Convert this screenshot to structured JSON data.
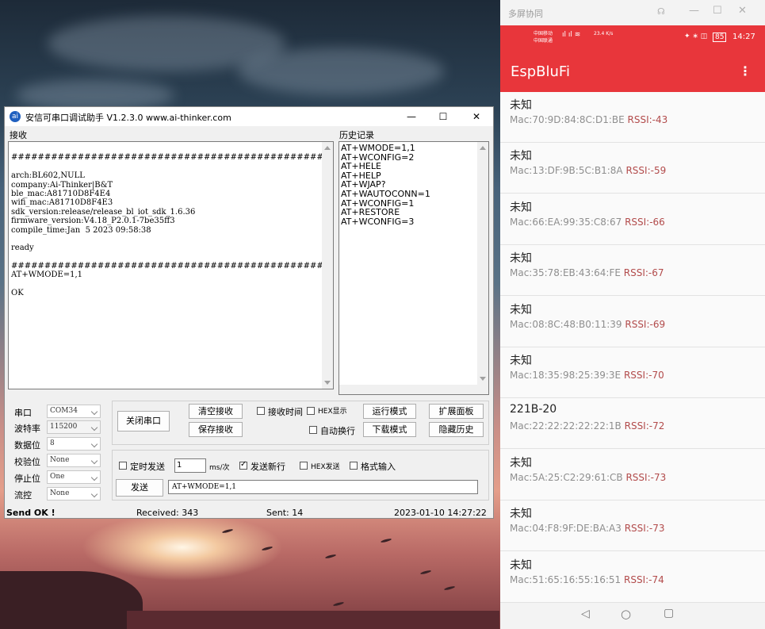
{
  "serial": {
    "title": "安信可串口调试助手 V1.2.3.0   www.ai-thinker.com",
    "receive_label": "接收",
    "history_label": "历史记录",
    "receive_lines": [
      "",
      "################################################",
      "",
      "arch:BL602,NULL",
      "company:Ai-Thinker|B&T",
      "ble_mac:A81710D8F4E4",
      "wifi_mac:A81710D8F4E3",
      "sdk_version:release/release_bl_iot_sdk_1.6.36",
      "firmware_version:V4.18_P2.0.1-7be35ff3",
      "compile_time:Jan  5 2023 09:58:38",
      "",
      "ready",
      "",
      "################################################",
      "AT+WMODE=1,1",
      "",
      "OK"
    ],
    "history": [
      "AT+WMODE=1,1",
      "AT+WCONFIG=2",
      "AT+HELE",
      "AT+HELP",
      "AT+WJAP?",
      "AT+WAUTOCONN=1",
      "AT+WCONFIG=1",
      "AT+RESTORE",
      "AT+WCONFIG=3"
    ],
    "port_label": "串口",
    "port_value": "COM34",
    "baud_label": "波特率",
    "baud_value": "115200",
    "databits_label": "数据位",
    "databits_value": "8",
    "parity_label": "校验位",
    "parity_value": "None",
    "stopbits_label": "停止位",
    "stopbits_value": "One",
    "flow_label": "流控",
    "flow_value": "None",
    "close_port": "关闭串口",
    "clear_recv": "清空接收",
    "save_recv": "保存接收",
    "recv_time": "接收时间",
    "hex_display": "HEX显示",
    "auto_wrap": "自动换行",
    "run_mode": "运行模式",
    "download_mode": "下载模式",
    "expand_panel": "扩展面板",
    "hide_history": "隐藏历史",
    "timed_send": "定时发送",
    "interval_value": "1",
    "interval_unit": "ms/次",
    "send_newline": "发送新行",
    "hex_send": "HEX发送",
    "format_input": "格式输入",
    "send_button": "发送",
    "send_text": "AT+WMODE=1,1",
    "status_ok": "Send OK !",
    "received": "Received: 343",
    "sent": "Sent: 14",
    "datetime": "2023-01-10 14:27:22"
  },
  "phone": {
    "mirror_title": "多屏协同",
    "carrier1": "中国移动",
    "carrier2": "中国联通",
    "net_speed": "23.4 K/s",
    "battery": "85",
    "clock": "14:27",
    "app_title": "EspBluFi",
    "devices": [
      {
        "name": "未知",
        "mac": "Mac:70:9D:84:8C:D1:BE",
        "rssi": "RSSI:-43"
      },
      {
        "name": "未知",
        "mac": "Mac:13:DF:9B:5C:B1:8A",
        "rssi": "RSSI:-59"
      },
      {
        "name": "未知",
        "mac": "Mac:66:EA:99:35:C8:67",
        "rssi": "RSSI:-66"
      },
      {
        "name": "未知",
        "mac": "Mac:35:78:EB:43:64:FE",
        "rssi": "RSSI:-67"
      },
      {
        "name": "未知",
        "mac": "Mac:08:8C:48:B0:11:39",
        "rssi": "RSSI:-69"
      },
      {
        "name": "未知",
        "mac": "Mac:18:35:98:25:39:3E",
        "rssi": "RSSI:-70"
      },
      {
        "name": "221B-20",
        "mac": "Mac:22:22:22:22:22:1B",
        "rssi": "RSSI:-72"
      },
      {
        "name": "未知",
        "mac": "Mac:5A:25:C2:29:61:CB",
        "rssi": "RSSI:-73"
      },
      {
        "name": "未知",
        "mac": "Mac:04:F8:9F:DE:BA:A3",
        "rssi": "RSSI:-73"
      },
      {
        "name": "未知",
        "mac": "Mac:51:65:16:55:16:51",
        "rssi": "RSSI:-74"
      }
    ]
  }
}
